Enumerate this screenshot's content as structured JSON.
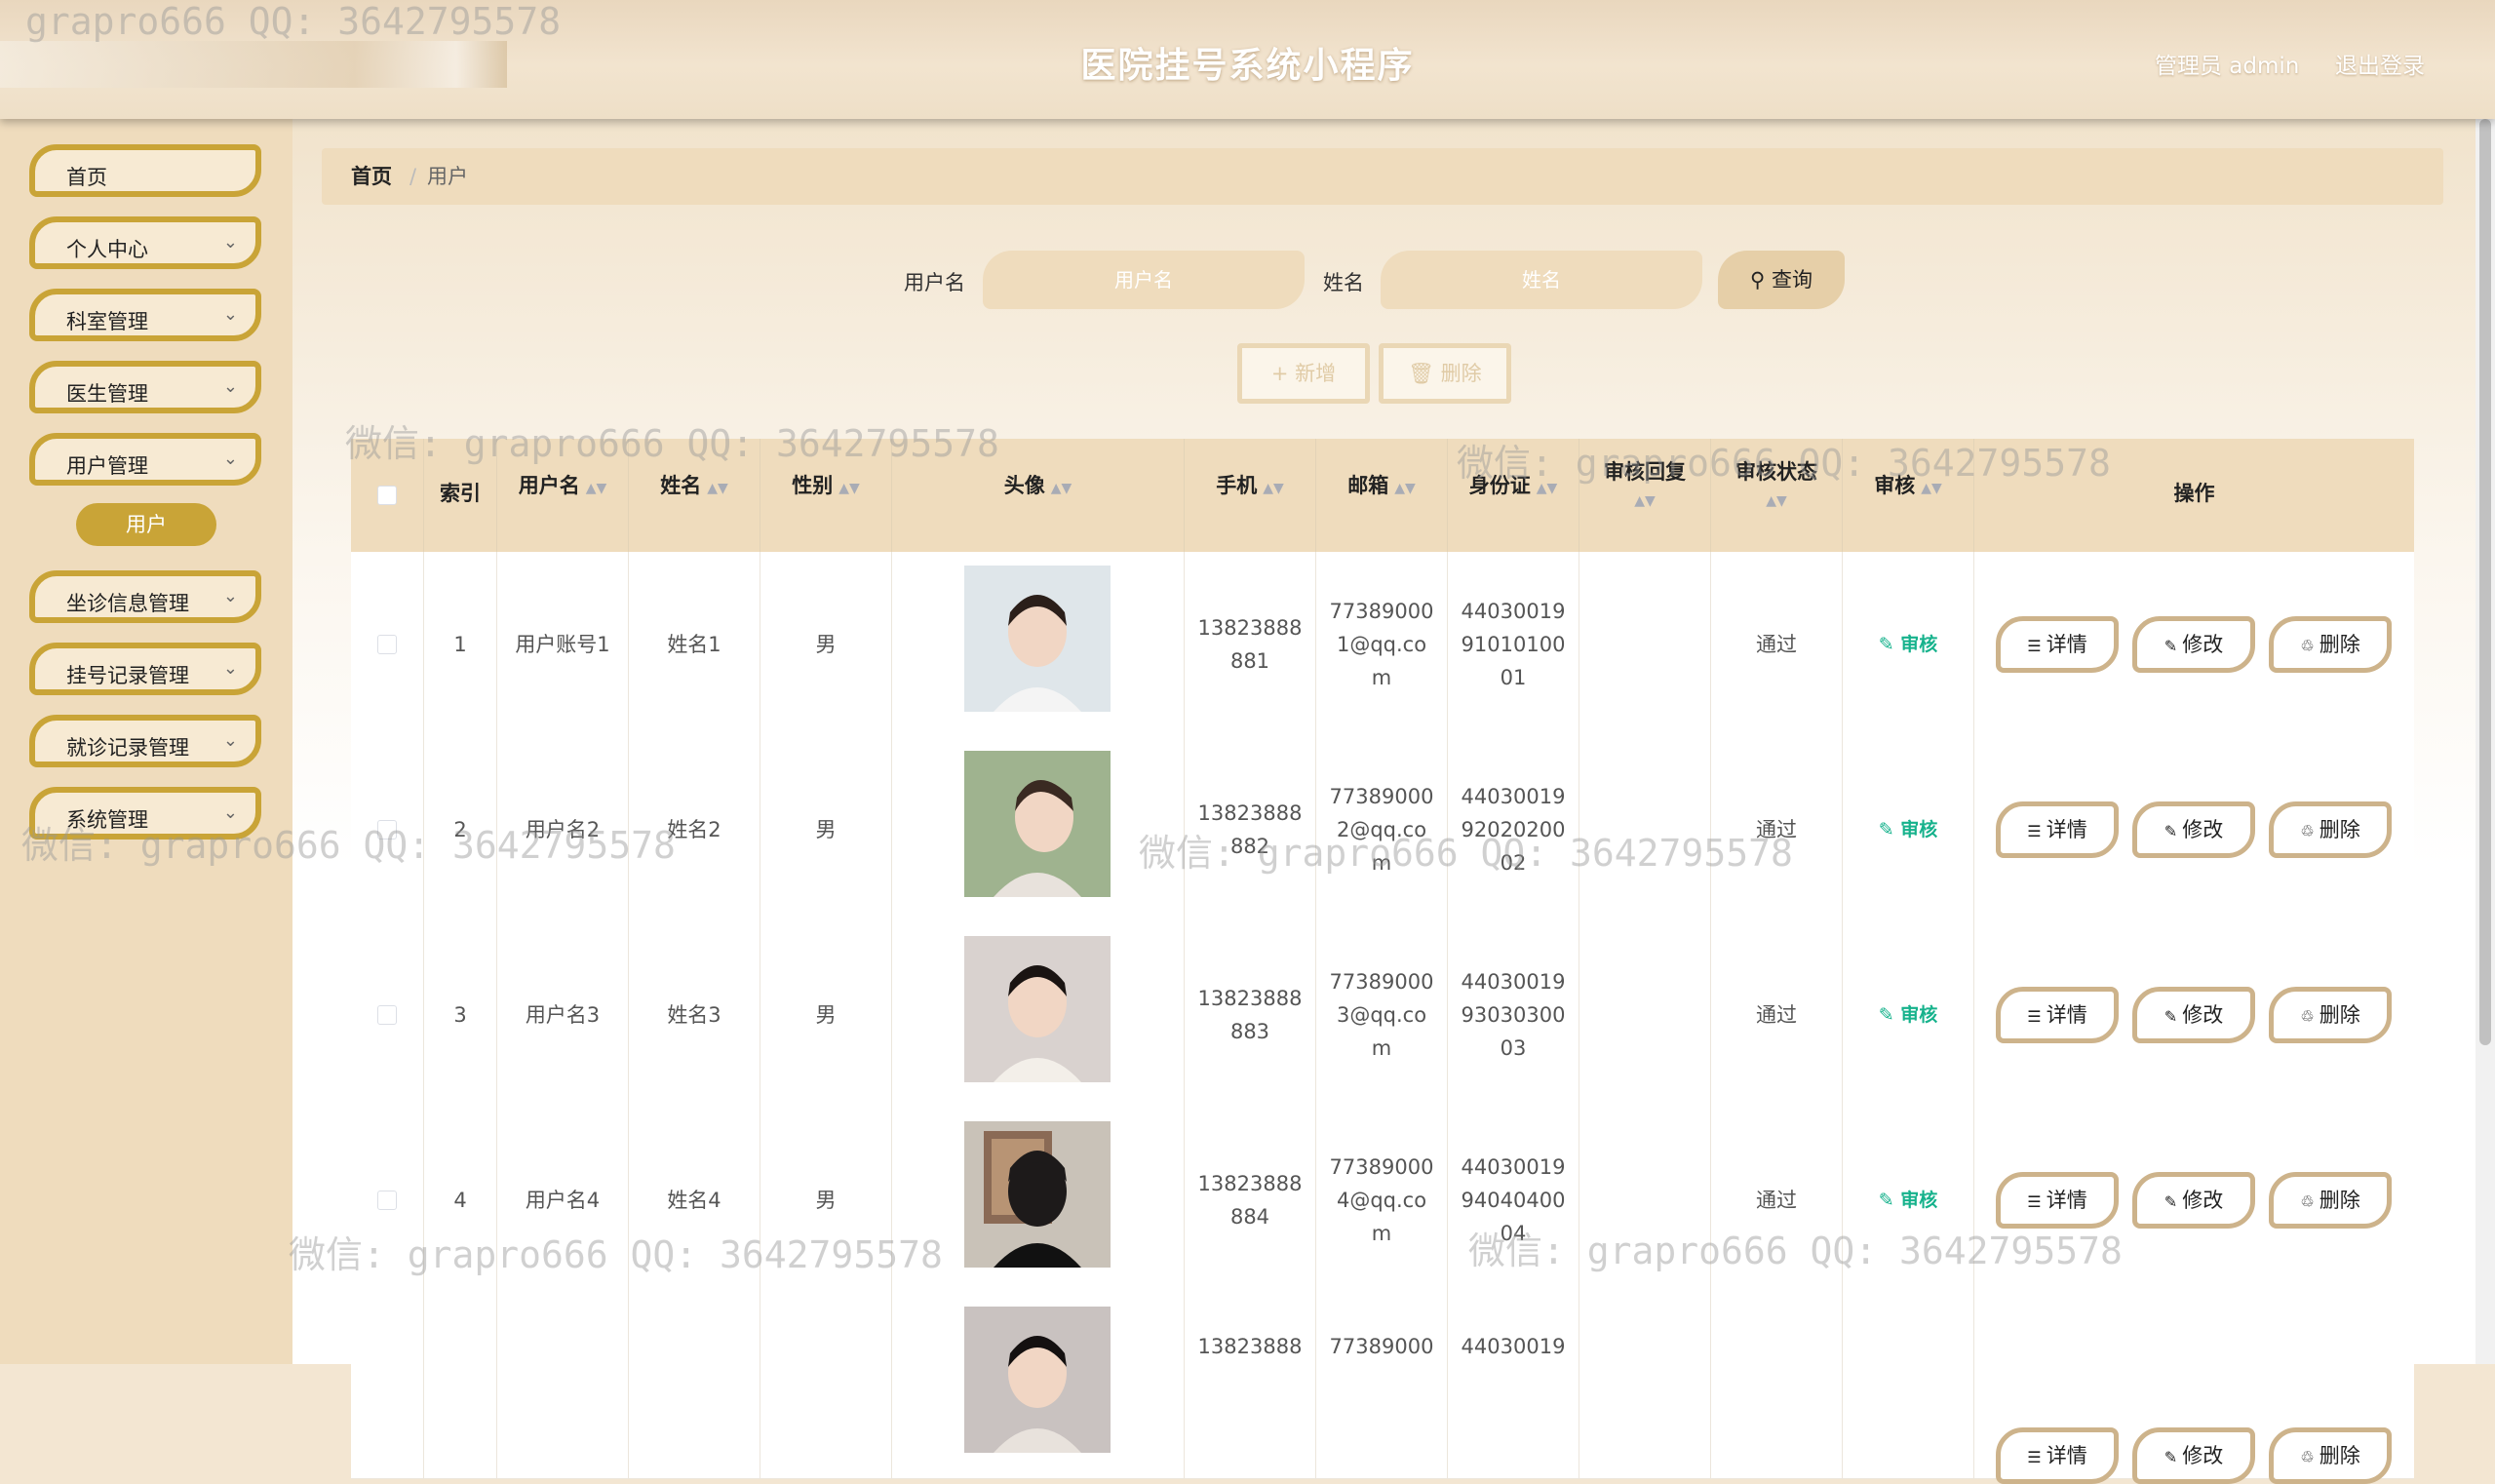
{
  "header": {
    "title": "医院挂号系统小程序",
    "admin": "管理员 admin",
    "logout": "退出登录"
  },
  "sidebar": {
    "items": [
      {
        "label": "首页",
        "chevron": false
      },
      {
        "label": "个人中心",
        "chevron": true
      },
      {
        "label": "科室管理",
        "chevron": true
      },
      {
        "label": "医生管理",
        "chevron": true
      },
      {
        "label": "用户管理",
        "chevron": true
      },
      {
        "label": "坐诊信息管理",
        "chevron": true
      },
      {
        "label": "挂号记录管理",
        "chevron": true
      },
      {
        "label": "就诊记录管理",
        "chevron": true
      },
      {
        "label": "系统管理",
        "chevron": true
      }
    ],
    "active_sub": "用户"
  },
  "breadcrumb": {
    "home": "首页",
    "sep": "/",
    "current": "用户"
  },
  "search": {
    "username_label": "用户名",
    "username_placeholder": "用户名",
    "name_label": "姓名",
    "name_placeholder": "姓名",
    "query_label": "查询"
  },
  "actions": {
    "add": "新增",
    "delete": "删除"
  },
  "table": {
    "headers": {
      "index": "索引",
      "username": "用户名",
      "name": "姓名",
      "gender": "性别",
      "avatar": "头像",
      "phone": "手机",
      "email": "邮箱",
      "idcard": "身份证",
      "audit_reply": "审核回复",
      "audit_status": "审核状态",
      "audit": "审核",
      "ops": "操作"
    },
    "rows": [
      {
        "index": "1",
        "username": "用户账号1",
        "name": "姓名1",
        "gender": "男",
        "phone": [
          "13823888",
          "881"
        ],
        "email": [
          "77389000",
          "1@qq.co",
          "m"
        ],
        "idcard": [
          "44030019",
          "91010100",
          "01"
        ],
        "reply": "",
        "status": "通过",
        "audit": "审核"
      },
      {
        "index": "2",
        "username": "用户名2",
        "name": "姓名2",
        "gender": "男",
        "phone": [
          "13823888",
          "882"
        ],
        "email": [
          "77389000",
          "2@qq.co",
          "m"
        ],
        "idcard": [
          "44030019",
          "92020200",
          "02"
        ],
        "reply": "",
        "status": "通过",
        "audit": "审核"
      },
      {
        "index": "3",
        "username": "用户名3",
        "name": "姓名3",
        "gender": "男",
        "phone": [
          "13823888",
          "883"
        ],
        "email": [
          "77389000",
          "3@qq.co",
          "m"
        ],
        "idcard": [
          "44030019",
          "93030300",
          "03"
        ],
        "reply": "",
        "status": "通过",
        "audit": "审核"
      },
      {
        "index": "4",
        "username": "用户名4",
        "name": "姓名4",
        "gender": "男",
        "phone": [
          "13823888",
          "884"
        ],
        "email": [
          "77389000",
          "4@qq.co",
          "m"
        ],
        "idcard": [
          "44030019",
          "94040400",
          "04"
        ],
        "reply": "",
        "status": "通过",
        "audit": "审核"
      },
      {
        "index": "",
        "username": "",
        "name": "",
        "gender": "",
        "phone": [
          "13823888"
        ],
        "email": [
          "77389000"
        ],
        "idcard": [
          "44030019"
        ],
        "reply": "",
        "status": "",
        "audit": ""
      }
    ],
    "op_buttons": {
      "detail": "详情",
      "edit": "修改",
      "delete": "删除"
    }
  },
  "watermarks": [
    "grapro666 QQ: 3642795578",
    "微信: grapro666 QQ: 3642795578",
    "微信: grapro666 QQ: 3642795578",
    "微信: grapro666 QQ: 3642795578",
    "微信: grapro666 QQ: 3642795578",
    "微信: grapro666 QQ: 3642795578",
    "微信: grapro666 QQ: 3642795578"
  ],
  "colors": {
    "accent": "#c9a437",
    "header_bg": "#eedfc7",
    "audit_green": "#16b28c"
  }
}
